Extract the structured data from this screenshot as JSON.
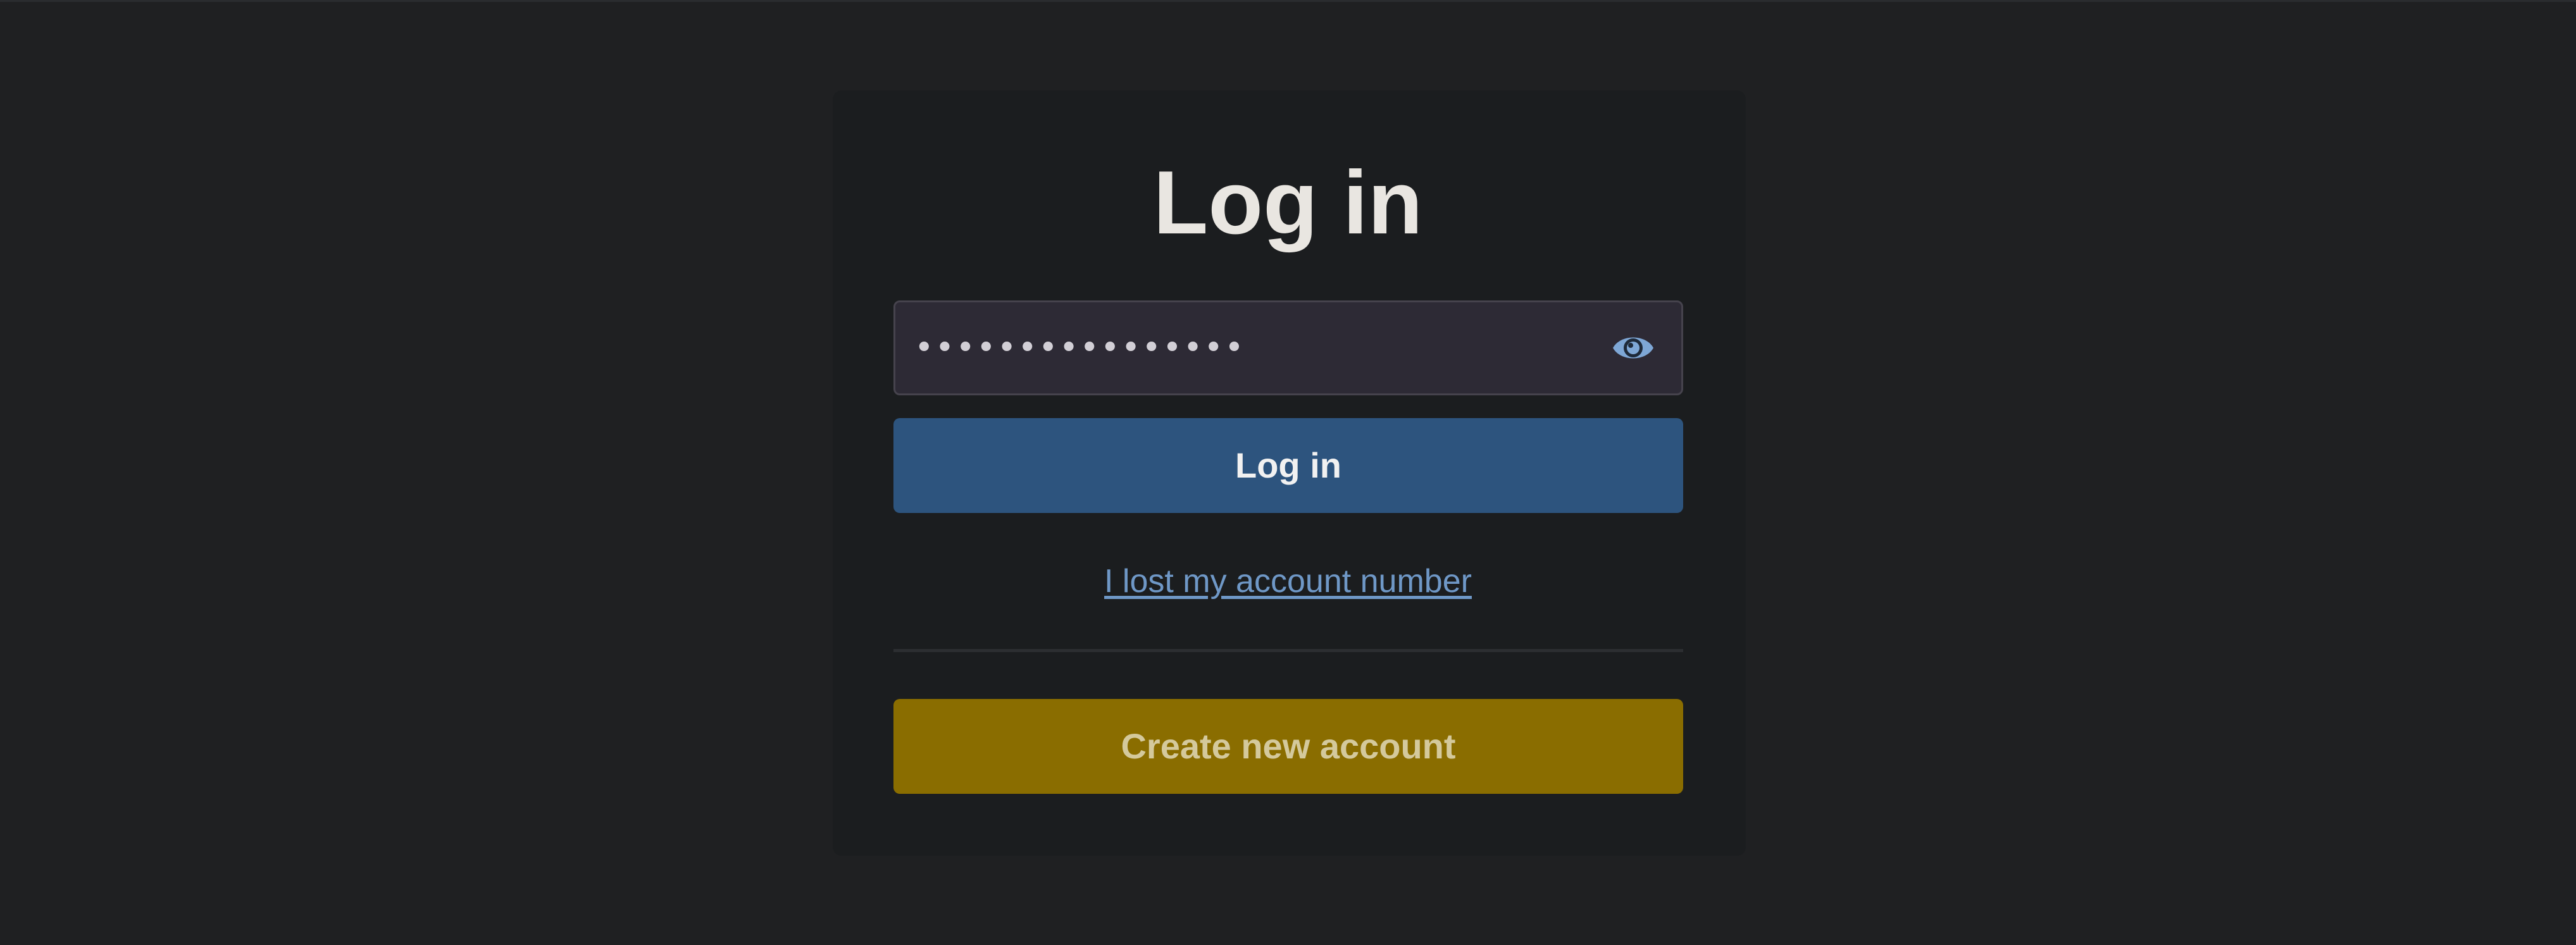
{
  "page": {
    "title": "Log in"
  },
  "form": {
    "password_value": "••••••••••••••••",
    "toggle_visibility_icon": "eye-icon",
    "login_button_label": "Log in",
    "lost_account_link": "I lost my account number",
    "create_account_button_label": "Create new account"
  },
  "colors": {
    "background": "#1f2022",
    "card": "#1b1d1f",
    "login_button": "#2d547e",
    "create_button": "#8a6d00",
    "link": "#6f98c7",
    "input_background": "#2d2a35"
  }
}
